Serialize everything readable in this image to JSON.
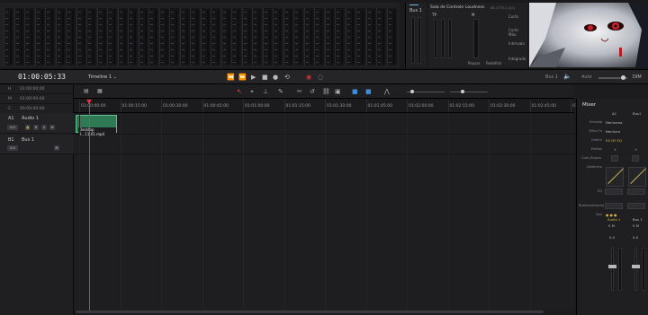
{
  "transport": {
    "timecode": "01:00:05:33",
    "timeline_name": "Timeline 1",
    "buttons": [
      "rewind",
      "fast-forward",
      "play",
      "stop",
      "record",
      "loop"
    ]
  },
  "meters": {
    "bus_label": "Bus 1",
    "loudness": {
      "tabs": [
        "Sala de Controle",
        "Loudness",
        "BS.1770-1 (LU)"
      ],
      "left_labels": [
        "TP",
        "M"
      ],
      "right_labels": [
        "Curto",
        "Curto Máx.",
        "Intervalo",
        "Integrado"
      ],
      "bottom": [
        "Pausar",
        "Redefinir"
      ]
    }
  },
  "toolbar_right": {
    "bus": "Bus 1",
    "automation": "Auto",
    "dim": "DIM"
  },
  "timecodes": [
    {
      "label": "H",
      "value": "01:00:00:00"
    },
    {
      "label": "M",
      "value": "01:00:00:00"
    },
    {
      "label": "C",
      "value": "00:00:00:00"
    }
  ],
  "tracks": [
    {
      "id": "A1",
      "name": "Áudio 1",
      "level": "0.0",
      "buttons": [
        "R",
        "S",
        "M"
      ]
    },
    {
      "id": "B1",
      "name": "Bus 1",
      "level": "0.0",
      "buttons": [
        "M"
      ]
    }
  ],
  "ruler": [
    "01:00:00:00",
    "01:00:15:00",
    "01:00:30:00",
    "01:00:45:00",
    "01:01:00:00",
    "01:01:15:00",
    "01:01:30:00",
    "01:01:45:00",
    "01:02:00:00",
    "01:02:15:00",
    "01:02:30:00",
    "01:02:45:00",
    "01:03:00:00"
  ],
  "clip": {
    "label": "Desktop 2...11.01.mp4"
  },
  "mixer": {
    "title": "Mixer",
    "channels": [
      "A1",
      "Bus1"
    ],
    "rows": [
      "Entrada",
      "Trilha Fx",
      "Ordem",
      "Efeitos",
      "Com./Expan.",
      "Dinâmica",
      "EQ",
      "Balanceamento",
      "Bus"
    ],
    "input_value": "Nenhuma",
    "track_fx": "Nenhum",
    "order": "EX DY EQ",
    "bottom_labels": [
      "Áudio 1",
      "Bus 1"
    ],
    "fader_values": [
      "0.0",
      "0.0"
    ]
  }
}
